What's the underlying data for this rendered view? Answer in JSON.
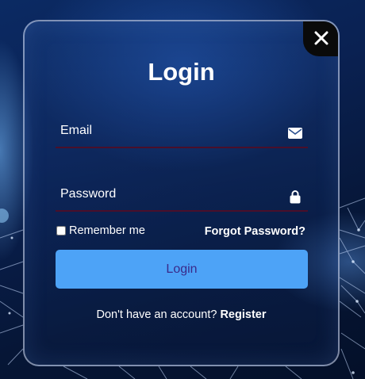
{
  "form": {
    "title": "Login",
    "close_icon": "close-icon",
    "email": {
      "value": "",
      "placeholder": "Email",
      "icon": "envelope-icon"
    },
    "password": {
      "value": "",
      "placeholder": "Password",
      "icon": "lock-icon"
    },
    "remember_label": "Remember me",
    "remember_checked": false,
    "forgot_label": "Forgot Password?",
    "submit_label": "Login",
    "register_prompt": "Don't have an account?",
    "register_label": "Register"
  },
  "colors": {
    "button": "#4da3f7",
    "button_text": "#3a2a8a",
    "underline": "#4a0f2a",
    "close_bg": "#0a0a0a"
  }
}
